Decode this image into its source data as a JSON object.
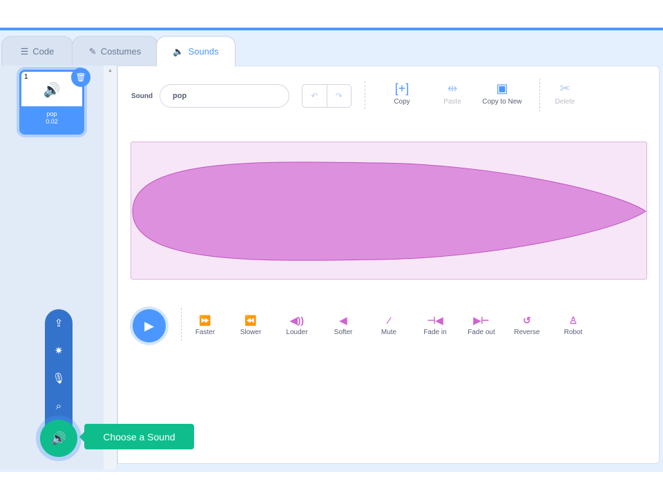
{
  "tabs": [
    {
      "label": "Code",
      "icon": "code-icon"
    },
    {
      "label": "Costumes",
      "icon": "brush-icon"
    },
    {
      "label": "Sounds",
      "icon": "speaker-icon",
      "active": true
    }
  ],
  "sound_list": [
    {
      "index": "1",
      "name": "pop",
      "duration": "0.02"
    }
  ],
  "editor": {
    "sound_label": "Sound",
    "sound_name": "pop",
    "tools": [
      {
        "label": "Copy",
        "enabled": true
      },
      {
        "label": "Paste",
        "enabled": false
      },
      {
        "label": "Copy to New",
        "enabled": true
      },
      {
        "label": "Delete",
        "enabled": false
      }
    ],
    "effects": [
      "Faster",
      "Slower",
      "Louder",
      "Softer",
      "Mute",
      "Fade in",
      "Fade out",
      "Reverse",
      "Robot"
    ]
  },
  "add_sound": {
    "tooltip": "Choose a Sound",
    "menu": [
      "upload-icon",
      "surprise-icon",
      "record-icon",
      "search-icon"
    ]
  },
  "colors": {
    "accent": "#4c97ff",
    "sound": "#cf63cf",
    "add": "#0fbd8c"
  }
}
